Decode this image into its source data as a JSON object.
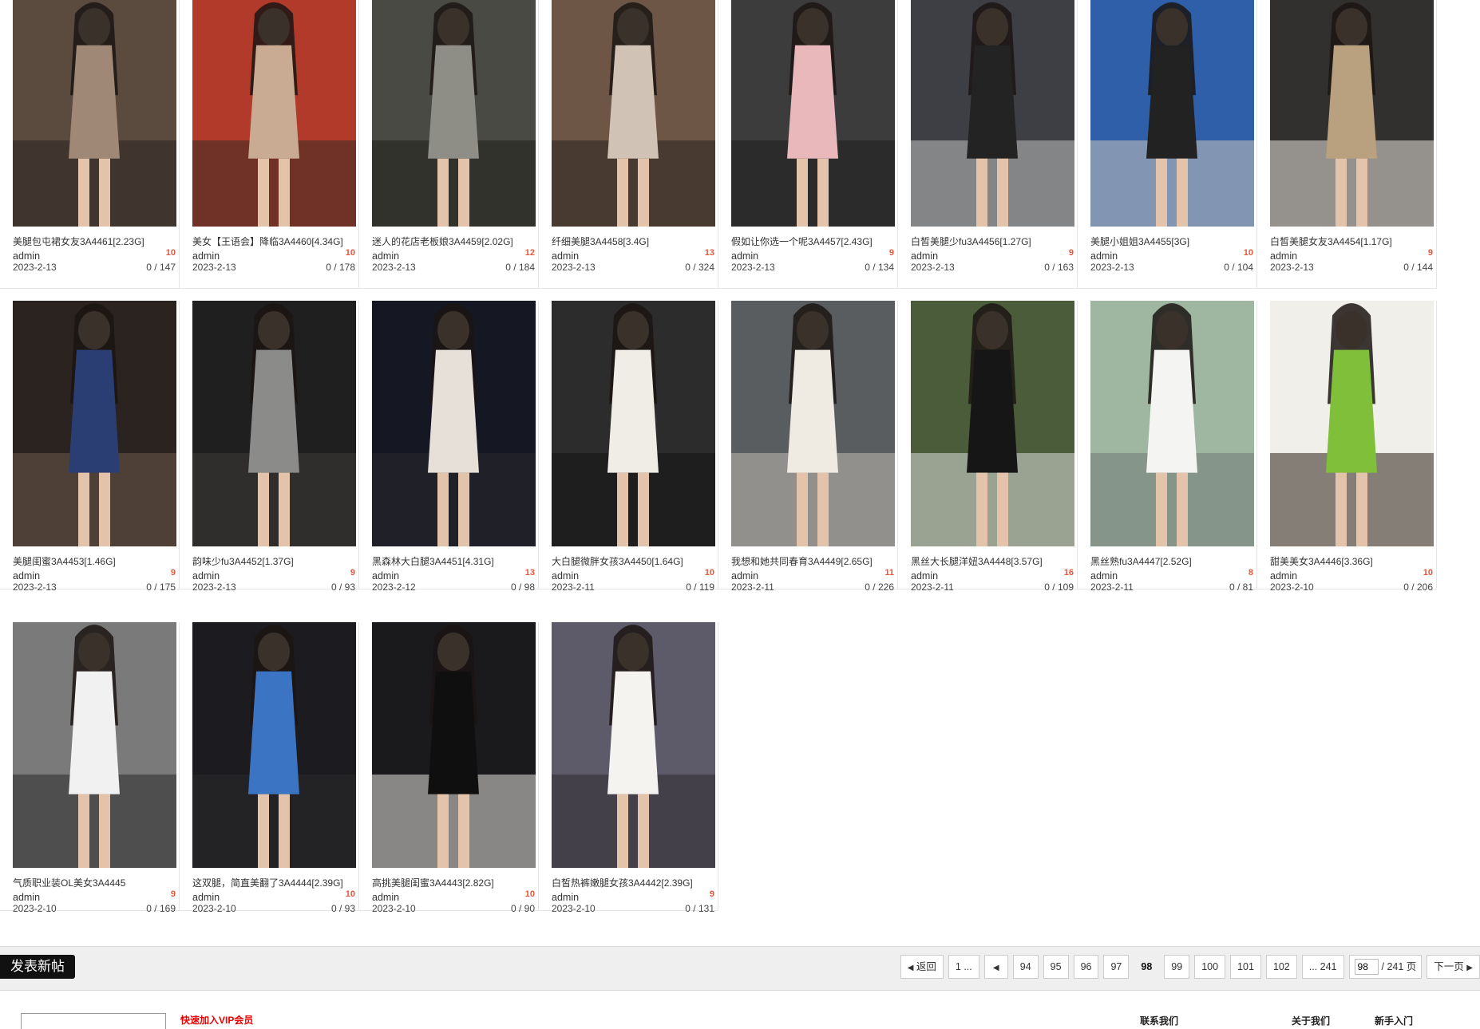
{
  "posts": [
    {
      "title": "美腿包屯裙女友3A4461[2.23G]",
      "author": "admin",
      "count": "10",
      "date": "2023-2-13",
      "stat": "0 / 147"
    },
    {
      "title": "美女【王语会】降临3A4460[4.34G]",
      "author": "admin",
      "count": "10",
      "date": "2023-2-13",
      "stat": "0 / 178"
    },
    {
      "title": "迷人的花店老板娘3A4459[2.02G]",
      "author": "admin",
      "count": "12",
      "date": "2023-2-13",
      "stat": "0 / 184"
    },
    {
      "title": "纤细美腿3A4458[3.4G]",
      "author": "admin",
      "count": "13",
      "date": "2023-2-13",
      "stat": "0 / 324"
    },
    {
      "title": "假如让你选一个呢3A4457[2.43G]",
      "author": "admin",
      "count": "9",
      "date": "2023-2-13",
      "stat": "0 / 134"
    },
    {
      "title": "白皙美腿少fu3A4456[1.27G]",
      "author": "admin",
      "count": "9",
      "date": "2023-2-13",
      "stat": "0 / 163"
    },
    {
      "title": "美腿小姐姐3A4455[3G]",
      "author": "admin",
      "count": "10",
      "date": "2023-2-13",
      "stat": "0 / 104"
    },
    {
      "title": "白皙美腿女友3A4454[1.17G]",
      "author": "admin",
      "count": "9",
      "date": "2023-2-13",
      "stat": "0 / 144"
    },
    {
      "title": "美腿闺蜜3A4453[1.46G]",
      "author": "admin",
      "count": "9",
      "date": "2023-2-13",
      "stat": "0 / 175"
    },
    {
      "title": "韵味少fu3A4452[1.37G]",
      "author": "admin",
      "count": "9",
      "date": "2023-2-13",
      "stat": "0 / 93"
    },
    {
      "title": "黑森林大白腿3A4451[4.31G]",
      "author": "admin",
      "count": "13",
      "date": "2023-2-12",
      "stat": "0 / 98"
    },
    {
      "title": "大白腿微胖女孩3A4450[1.64G]",
      "author": "admin",
      "count": "10",
      "date": "2023-2-11",
      "stat": "0 / 119"
    },
    {
      "title": "我想和她共同春育3A4449[2.65G]",
      "author": "admin",
      "count": "11",
      "date": "2023-2-11",
      "stat": "0 / 226"
    },
    {
      "title": "黑丝大长腿洋妞3A4448[3.57G]",
      "author": "admin",
      "count": "16",
      "date": "2023-2-11",
      "stat": "0 / 109"
    },
    {
      "title": "黑丝熟fu3A4447[2.52G]",
      "author": "admin",
      "count": "8",
      "date": "2023-2-11",
      "stat": "0 / 81"
    },
    {
      "title": "甜美美女3A4446[3.36G]",
      "author": "admin",
      "count": "10",
      "date": "2023-2-10",
      "stat": "0 / 206"
    },
    {
      "title": "气质职业装OL美女3A4445",
      "author": "admin",
      "count": "9",
      "date": "2023-2-10",
      "stat": "0 / 169"
    },
    {
      "title": "这双腿，简直美翻了3A4444[2.39G]",
      "author": "admin",
      "count": "10",
      "date": "2023-2-10",
      "stat": "0 / 93"
    },
    {
      "title": "高挑美腿闺蜜3A4443[2.82G]",
      "author": "admin",
      "count": "10",
      "date": "2023-2-10",
      "stat": "0 / 90"
    },
    {
      "title": "白皙热裤嫩腿女孩3A4442[2.39G]",
      "author": "admin",
      "count": "9",
      "date": "2023-2-10",
      "stat": "0 / 131"
    }
  ],
  "post_button": "发表新帖",
  "pager": {
    "back": "返回",
    "first": "1 ...",
    "pages": [
      "94",
      "95",
      "96",
      "97",
      "98",
      "99",
      "100",
      "101",
      "102"
    ],
    "current": "98",
    "last": "... 241",
    "input_value": "98",
    "total": "/ 241 页",
    "next": "下一页"
  },
  "footer": {
    "link": "快速加入VIP会员",
    "nav": [
      "联系我们",
      "关于我们",
      "新手入门"
    ]
  },
  "colors": {
    "count": "#e6563c",
    "post_button_bg": "#111111",
    "pagebar_bg": "#efefef"
  }
}
